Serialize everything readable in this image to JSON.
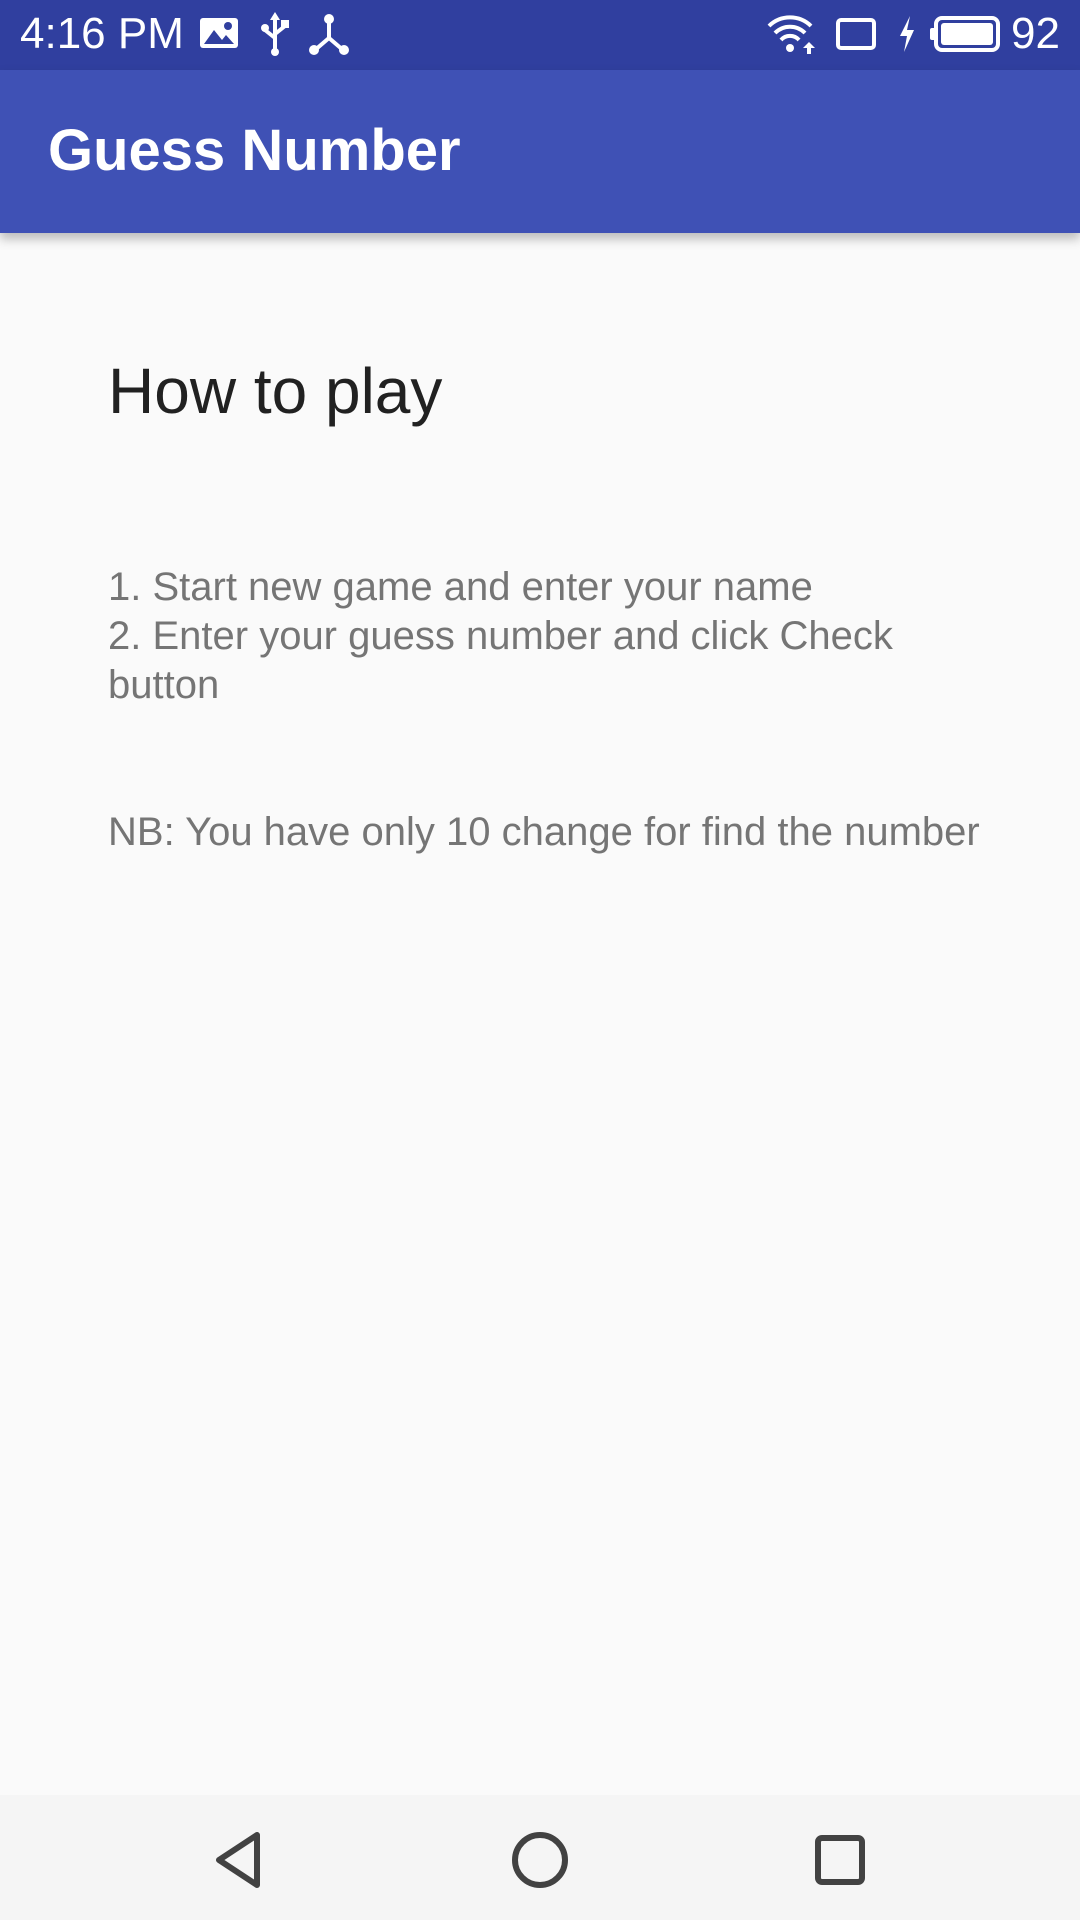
{
  "status_bar": {
    "time": "4:16 PM",
    "battery_level": "92",
    "left_icons": [
      "image-icon",
      "usb-icon",
      "share-hub-icon"
    ],
    "right_icons": [
      "wifi-icon",
      "cast-icon",
      "charging-icon",
      "battery-icon"
    ],
    "background_color": "#303f9f"
  },
  "app_bar": {
    "title": "Guess Number",
    "background_color": "#3f51b5"
  },
  "content": {
    "heading": "How to play",
    "steps": [
      "1. Start new game and enter your name",
      "2. Enter your guess number and click Check",
      "button"
    ],
    "note": "NB: You have only 10 change for find the number"
  },
  "nav_bar": {
    "buttons": [
      "back-icon",
      "home-icon",
      "recents-icon"
    ]
  }
}
